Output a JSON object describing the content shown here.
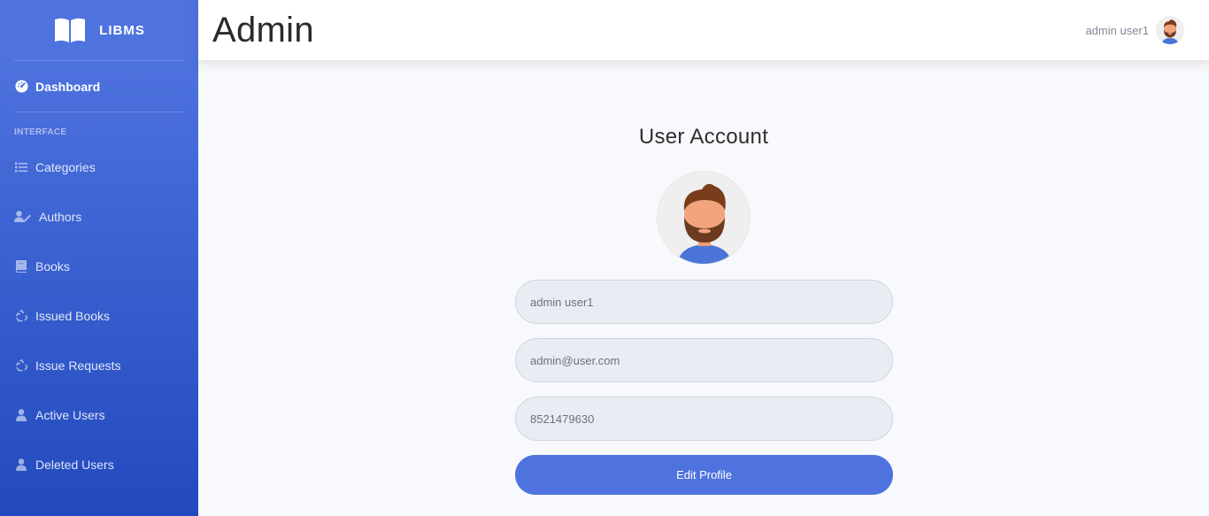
{
  "brand": {
    "name": "LIBMS"
  },
  "sidebar": {
    "dashboard": "Dashboard",
    "heading": "INTERFACE",
    "items": [
      {
        "label": "Categories",
        "icon": "list-icon"
      },
      {
        "label": "Authors",
        "icon": "user-pen-icon"
      },
      {
        "label": "Books",
        "icon": "book-icon"
      },
      {
        "label": "Issued Books",
        "icon": "recycle-icon"
      },
      {
        "label": "Issue Requests",
        "icon": "recycle-icon"
      },
      {
        "label": "Active Users",
        "icon": "user-icon"
      },
      {
        "label": "Deleted Users",
        "icon": "user-icon"
      }
    ]
  },
  "topbar": {
    "title": "Admin",
    "user_name": "admin user1"
  },
  "account": {
    "title": "User Account",
    "name_value": "admin user1",
    "email_value": "admin@user.com",
    "phone_value": "8521479630",
    "edit_label": "Edit Profile"
  },
  "colors": {
    "primary": "#4e73df",
    "primary_dark": "#224abe"
  }
}
